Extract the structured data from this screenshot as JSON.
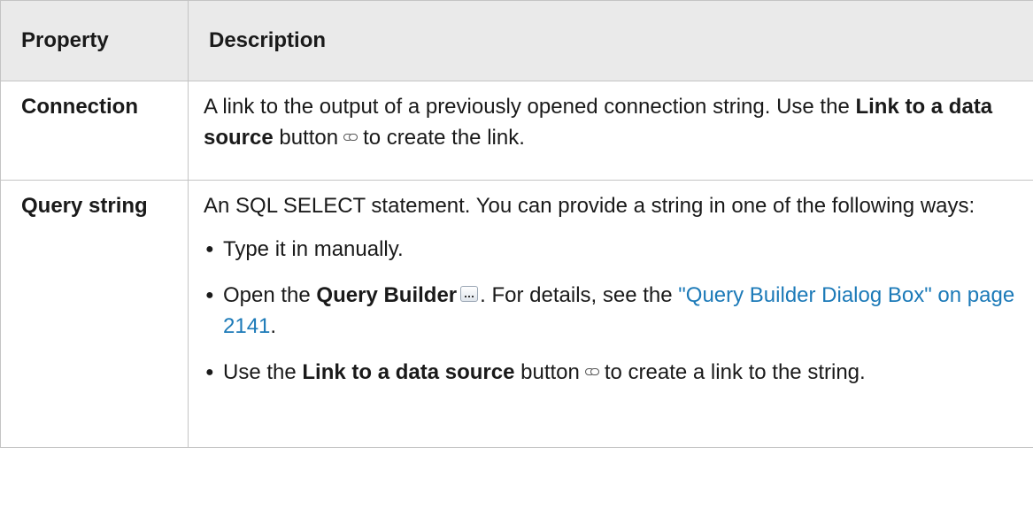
{
  "table": {
    "headers": {
      "property": "Property",
      "description": "Description"
    },
    "rows": [
      {
        "property": "Connection",
        "text_1": "A link to the output of a previously opened connection string. Use the ",
        "bold_1": "Link to a data source",
        "text_2": " button",
        "icon": "link-icon",
        "text_3": "to create the link."
      },
      {
        "property": "Query string",
        "intro": "An SQL SELECT statement. You can provide a string in one of the following ways:",
        "bullets": [
          {
            "text": "Type it in manually."
          },
          {
            "text_1": "Open the ",
            "bold": "Query Builder",
            "icon": "ellipsis-button-icon",
            "text_2": ". For details, see the ",
            "link": "\"Query Builder Dialog Box\" on page 2141",
            "text_3": "."
          },
          {
            "text_1": "Use the ",
            "bold": "Link to a data source",
            "text_2": " button",
            "icon": "link-icon",
            "text_3": "to create a link to the string."
          }
        ]
      }
    ]
  }
}
